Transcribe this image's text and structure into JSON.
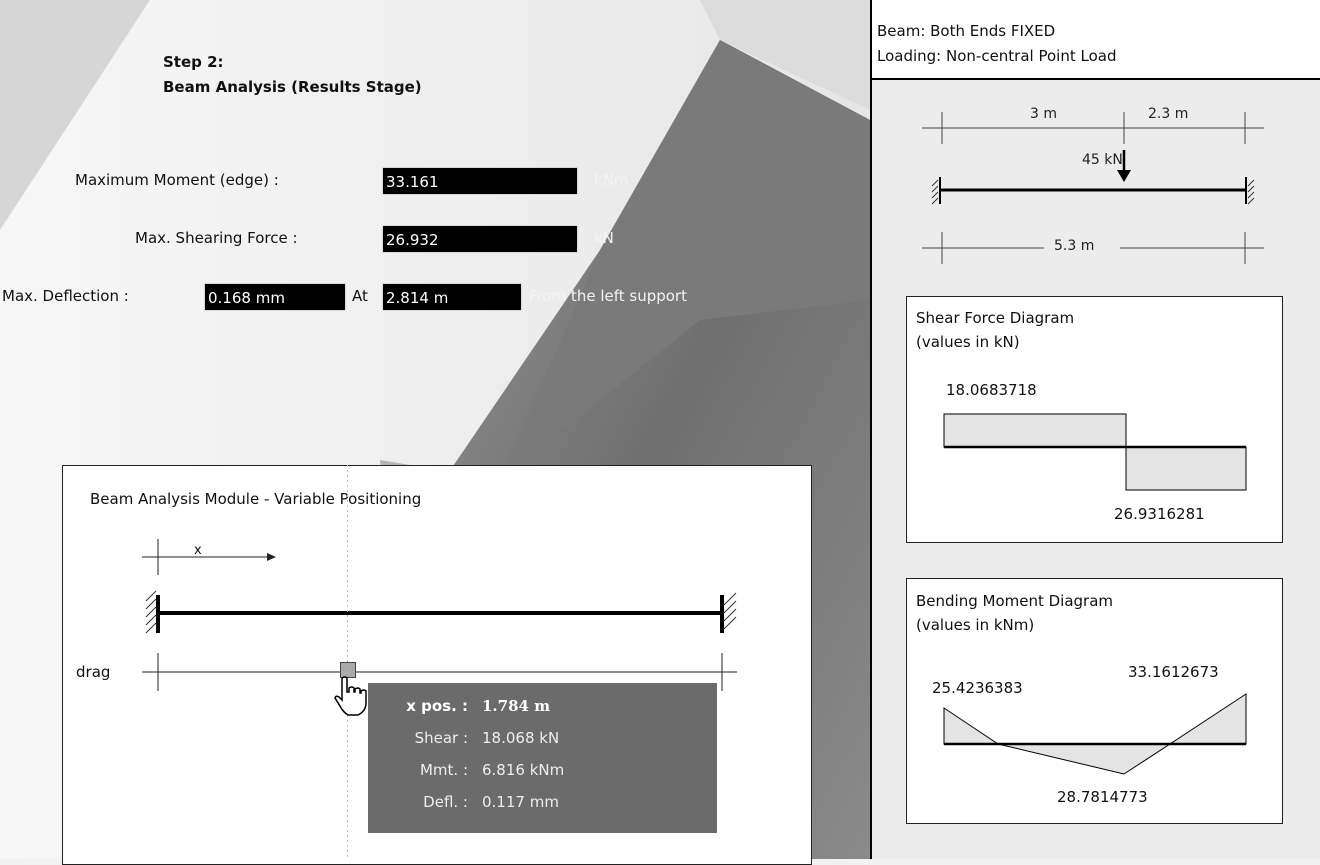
{
  "step": {
    "line1": "Step 2:",
    "line2": "Beam Analysis (Results Stage)"
  },
  "results": {
    "max_moment_label": "Maximum Moment (edge) :",
    "max_moment_value": "33.161",
    "max_moment_unit": "kNm",
    "max_shear_label": "Max. Shearing Force :",
    "max_shear_value": "26.932",
    "max_shear_unit": "kN",
    "max_defl_label": "Max. Deflection :",
    "max_defl_value": "0.168 mm",
    "at_label": "At",
    "at_value": "2.814 m",
    "from_label": "From the left support"
  },
  "module": {
    "title": "Beam Analysis Module - Variable Positioning",
    "x_label": "x",
    "drag_label": "drag",
    "slider_position": 0.336,
    "tooltip": {
      "xpos_key": "x pos. :",
      "xpos_val": "1.784 m",
      "shear_key": "Shear :",
      "shear_val": "18.068 kN",
      "mmt_key": "Mmt. :",
      "mmt_val": "6.816 kNm",
      "defl_key": "Defl. :",
      "defl_val": "0.117 mm"
    }
  },
  "panel": {
    "beam_line": "Beam: Both Ends FIXED",
    "loading_line": "Loading: Non-central Point Load",
    "dim_a": "3 m",
    "dim_b": "2.3 m",
    "load": "45 kN",
    "dim_total": "5.3 m"
  },
  "shear_diagram": {
    "title_line1": "Shear Force Diagram",
    "title_line2": "(values in kN)",
    "positive_value": "18.0683718",
    "negative_value": "26.9316281"
  },
  "moment_diagram": {
    "title_line1": "Bending Moment Diagram",
    "title_line2": "(values in kNm)",
    "left_value": "25.4236383",
    "right_value": "33.1612673",
    "mid_value": "28.7814773"
  },
  "colors": {
    "field_bg": "#000000",
    "tooltip_bg": "#6b6b6b",
    "diagram_fill": "#e4e4e4"
  }
}
